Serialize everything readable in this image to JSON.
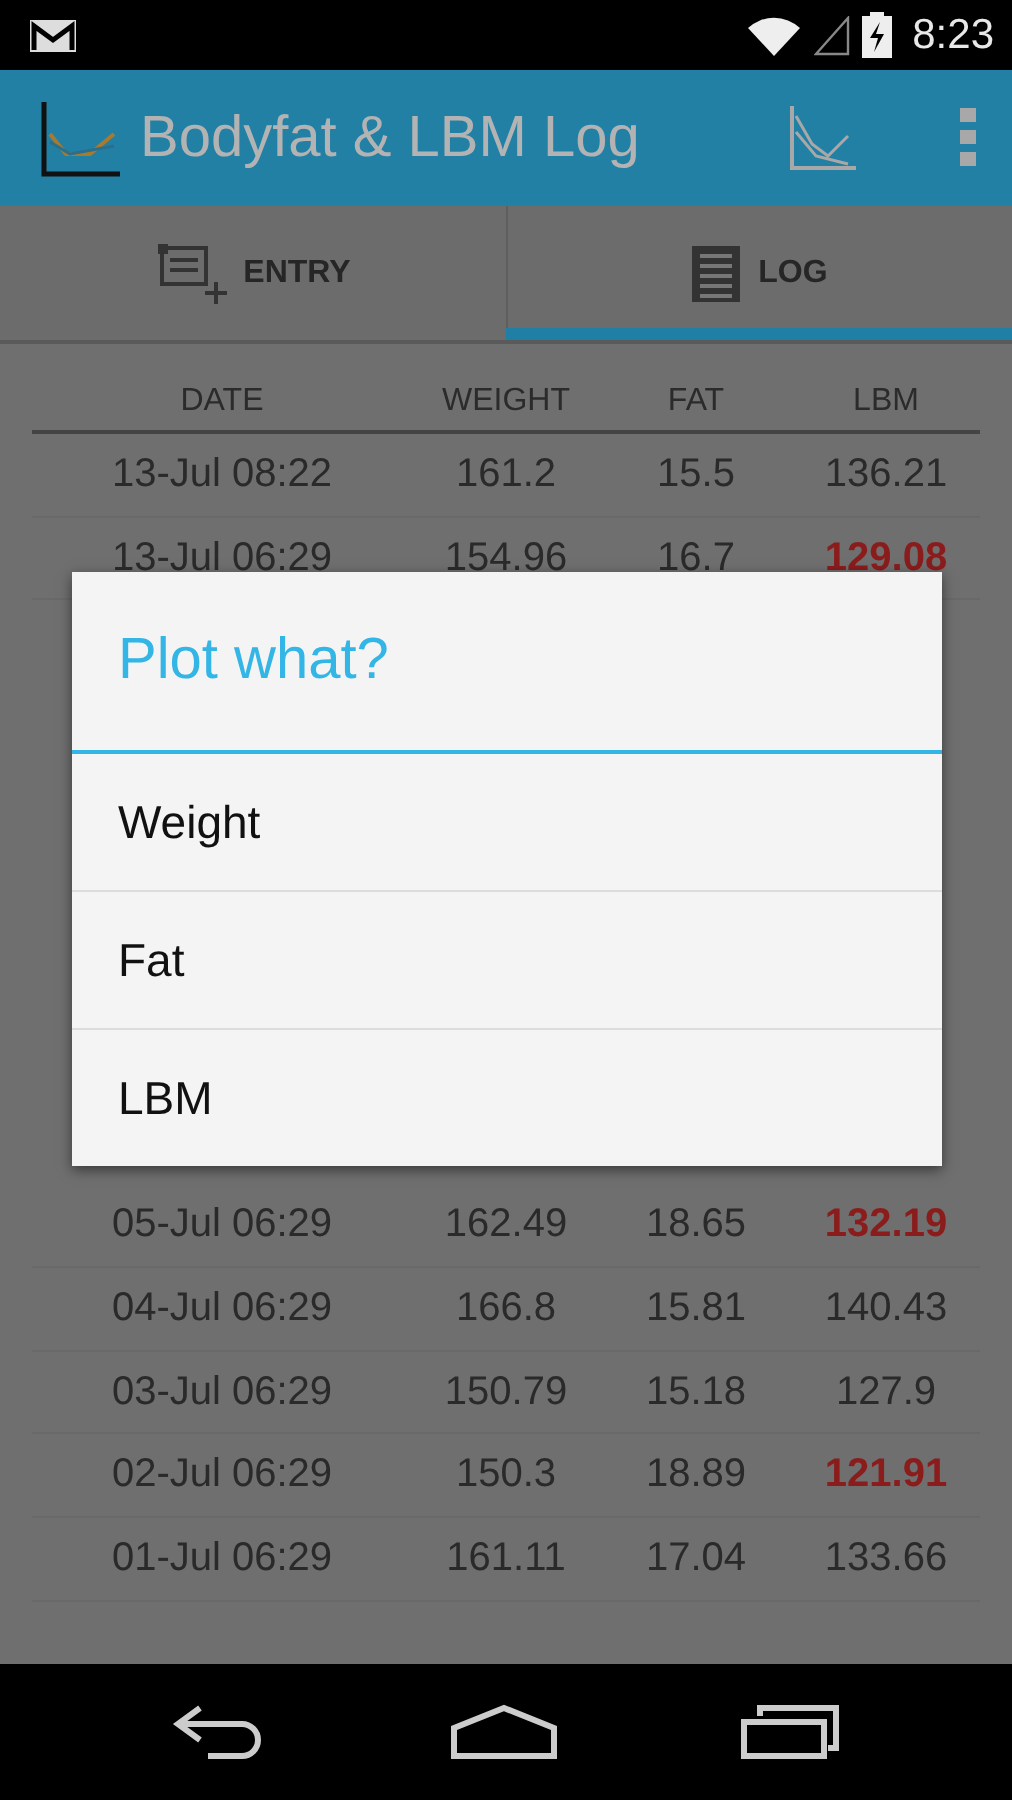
{
  "status_bar": {
    "time": "8:23"
  },
  "app_bar": {
    "title": "Bodyfat & LBM Log"
  },
  "tabs": [
    {
      "label": "ENTRY",
      "kind": "entry",
      "selected": false
    },
    {
      "label": "LOG",
      "kind": "log",
      "selected": true
    }
  ],
  "table": {
    "columns": [
      "DATE",
      "WEIGHT",
      "FAT",
      "LBM"
    ],
    "rows": [
      {
        "date": "13-Jul 08:22",
        "weight": "161.2",
        "fat": "15.5",
        "lbm": "136.21",
        "flagged": false
      },
      {
        "date": "13-Jul 06:29",
        "weight": "154.96",
        "fat": "16.7",
        "lbm": "129.08",
        "flagged": true
      },
      {
        "date": "05-Jul 06:29",
        "weight": "162.49",
        "fat": "18.65",
        "lbm": "132.19",
        "flagged": true
      },
      {
        "date": "04-Jul 06:29",
        "weight": "166.8",
        "fat": "15.81",
        "lbm": "140.43",
        "flagged": false
      },
      {
        "date": "03-Jul 06:29",
        "weight": "150.79",
        "fat": "15.18",
        "lbm": "127.9",
        "flagged": false
      },
      {
        "date": "02-Jul 06:29",
        "weight": "150.3",
        "fat": "18.89",
        "lbm": "121.91",
        "flagged": true
      },
      {
        "date": "01-Jul 06:29",
        "weight": "161.11",
        "fat": "17.04",
        "lbm": "133.66",
        "flagged": false
      }
    ]
  },
  "dialog": {
    "title": "Plot what?",
    "options": [
      "Weight",
      "Fat",
      "LBM"
    ]
  }
}
